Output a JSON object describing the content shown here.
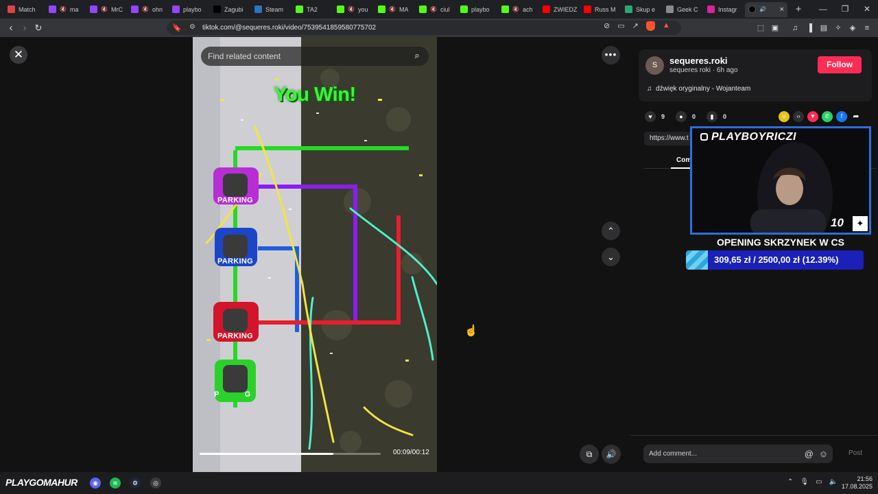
{
  "browser": {
    "tabs": [
      {
        "label": "Match",
        "color": "#e0443e",
        "muted": false
      },
      {
        "label": "ma",
        "color": "#9146ff",
        "muted": true
      },
      {
        "label": "MrC",
        "color": "#9146ff",
        "muted": true
      },
      {
        "label": "ohn",
        "color": "#9146ff",
        "muted": true
      },
      {
        "label": "playbo",
        "color": "#9146ff",
        "muted": false
      },
      {
        "label": "Zagubi",
        "color": "#000000",
        "muted": false
      },
      {
        "label": "Steam",
        "color": "#2a75bb",
        "muted": false
      },
      {
        "label": "TA2",
        "color": "#53fc18",
        "muted": false
      },
      {
        "label": "you",
        "color": "#53fc18",
        "muted": true
      },
      {
        "label": "MA",
        "color": "#53fc18",
        "muted": true
      },
      {
        "label": "ciul",
        "color": "#53fc18",
        "muted": true
      },
      {
        "label": "playbo",
        "color": "#53fc18",
        "muted": false
      },
      {
        "label": "ach",
        "color": "#53fc18",
        "muted": true
      },
      {
        "label": "ZWIEDZ",
        "color": "#ff0000",
        "muted": false
      },
      {
        "label": "Russ M",
        "color": "#ff0000",
        "muted": false
      },
      {
        "label": "Skup e",
        "color": "#2aa876",
        "muted": false
      },
      {
        "label": "Geek C",
        "color": "#8a8a8a",
        "muted": false
      },
      {
        "label": "Instagr",
        "color": "#d6249f",
        "muted": false
      }
    ],
    "active_tab_close": "×",
    "new_tab": "+",
    "url": "tiktok.com/@sequeres.roki/video/7539541859580775702"
  },
  "video": {
    "search_placeholder": "Find related content",
    "win_text": "You Win!",
    "parking_labels": [
      "PARKING",
      "PARKING",
      "PARKING",
      "P",
      "G"
    ],
    "progress": 0.74,
    "time": "00:09/00:12"
  },
  "author": {
    "avatar_letter": "S",
    "username": "sequeres.roki",
    "subline": "sequeres roki · 6h ago",
    "follow_label": "Follow",
    "music": "dźwięk oryginalny - Wojanteam"
  },
  "stats": {
    "likes": "9",
    "comments": "0",
    "saves": "0"
  },
  "link_text": "https://www.t",
  "comments_tab": "Com",
  "composer": {
    "placeholder": "Add comment...",
    "post_label": "Post"
  },
  "overlay": {
    "handle": "PLAYBOYRICZI",
    "number": "10",
    "title": "OPENING SKRZYNEK W CS",
    "goal_text": "309,65 zł / 2500,00 zł (12.39%)",
    "goal_fraction": 0.1239
  },
  "taskbar": {
    "brand": "PLAYGOMAHUR",
    "time": "21:56",
    "date": "17.08.2025"
  },
  "colors": {
    "accent_follow": "#fe2c55",
    "webcam_border": "#2a6fe0"
  }
}
